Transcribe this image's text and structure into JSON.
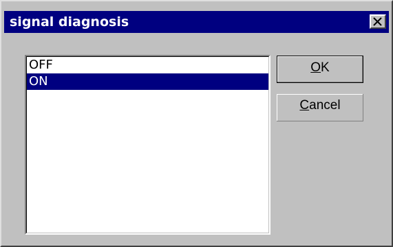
{
  "window": {
    "title": "signal diagnosis",
    "close_icon": "close-x-icon"
  },
  "listbox": {
    "items": [
      {
        "label": "OFF",
        "selected": false
      },
      {
        "label": "ON",
        "selected": true
      }
    ]
  },
  "buttons": {
    "ok": {
      "mnemonic": "O",
      "rest": "K",
      "is_default": true
    },
    "cancel": {
      "mnemonic": "C",
      "rest": "ancel",
      "is_default": false
    }
  },
  "colors": {
    "titlebar": "#000080",
    "face": "#c0c0c0",
    "selection": "#000080"
  }
}
